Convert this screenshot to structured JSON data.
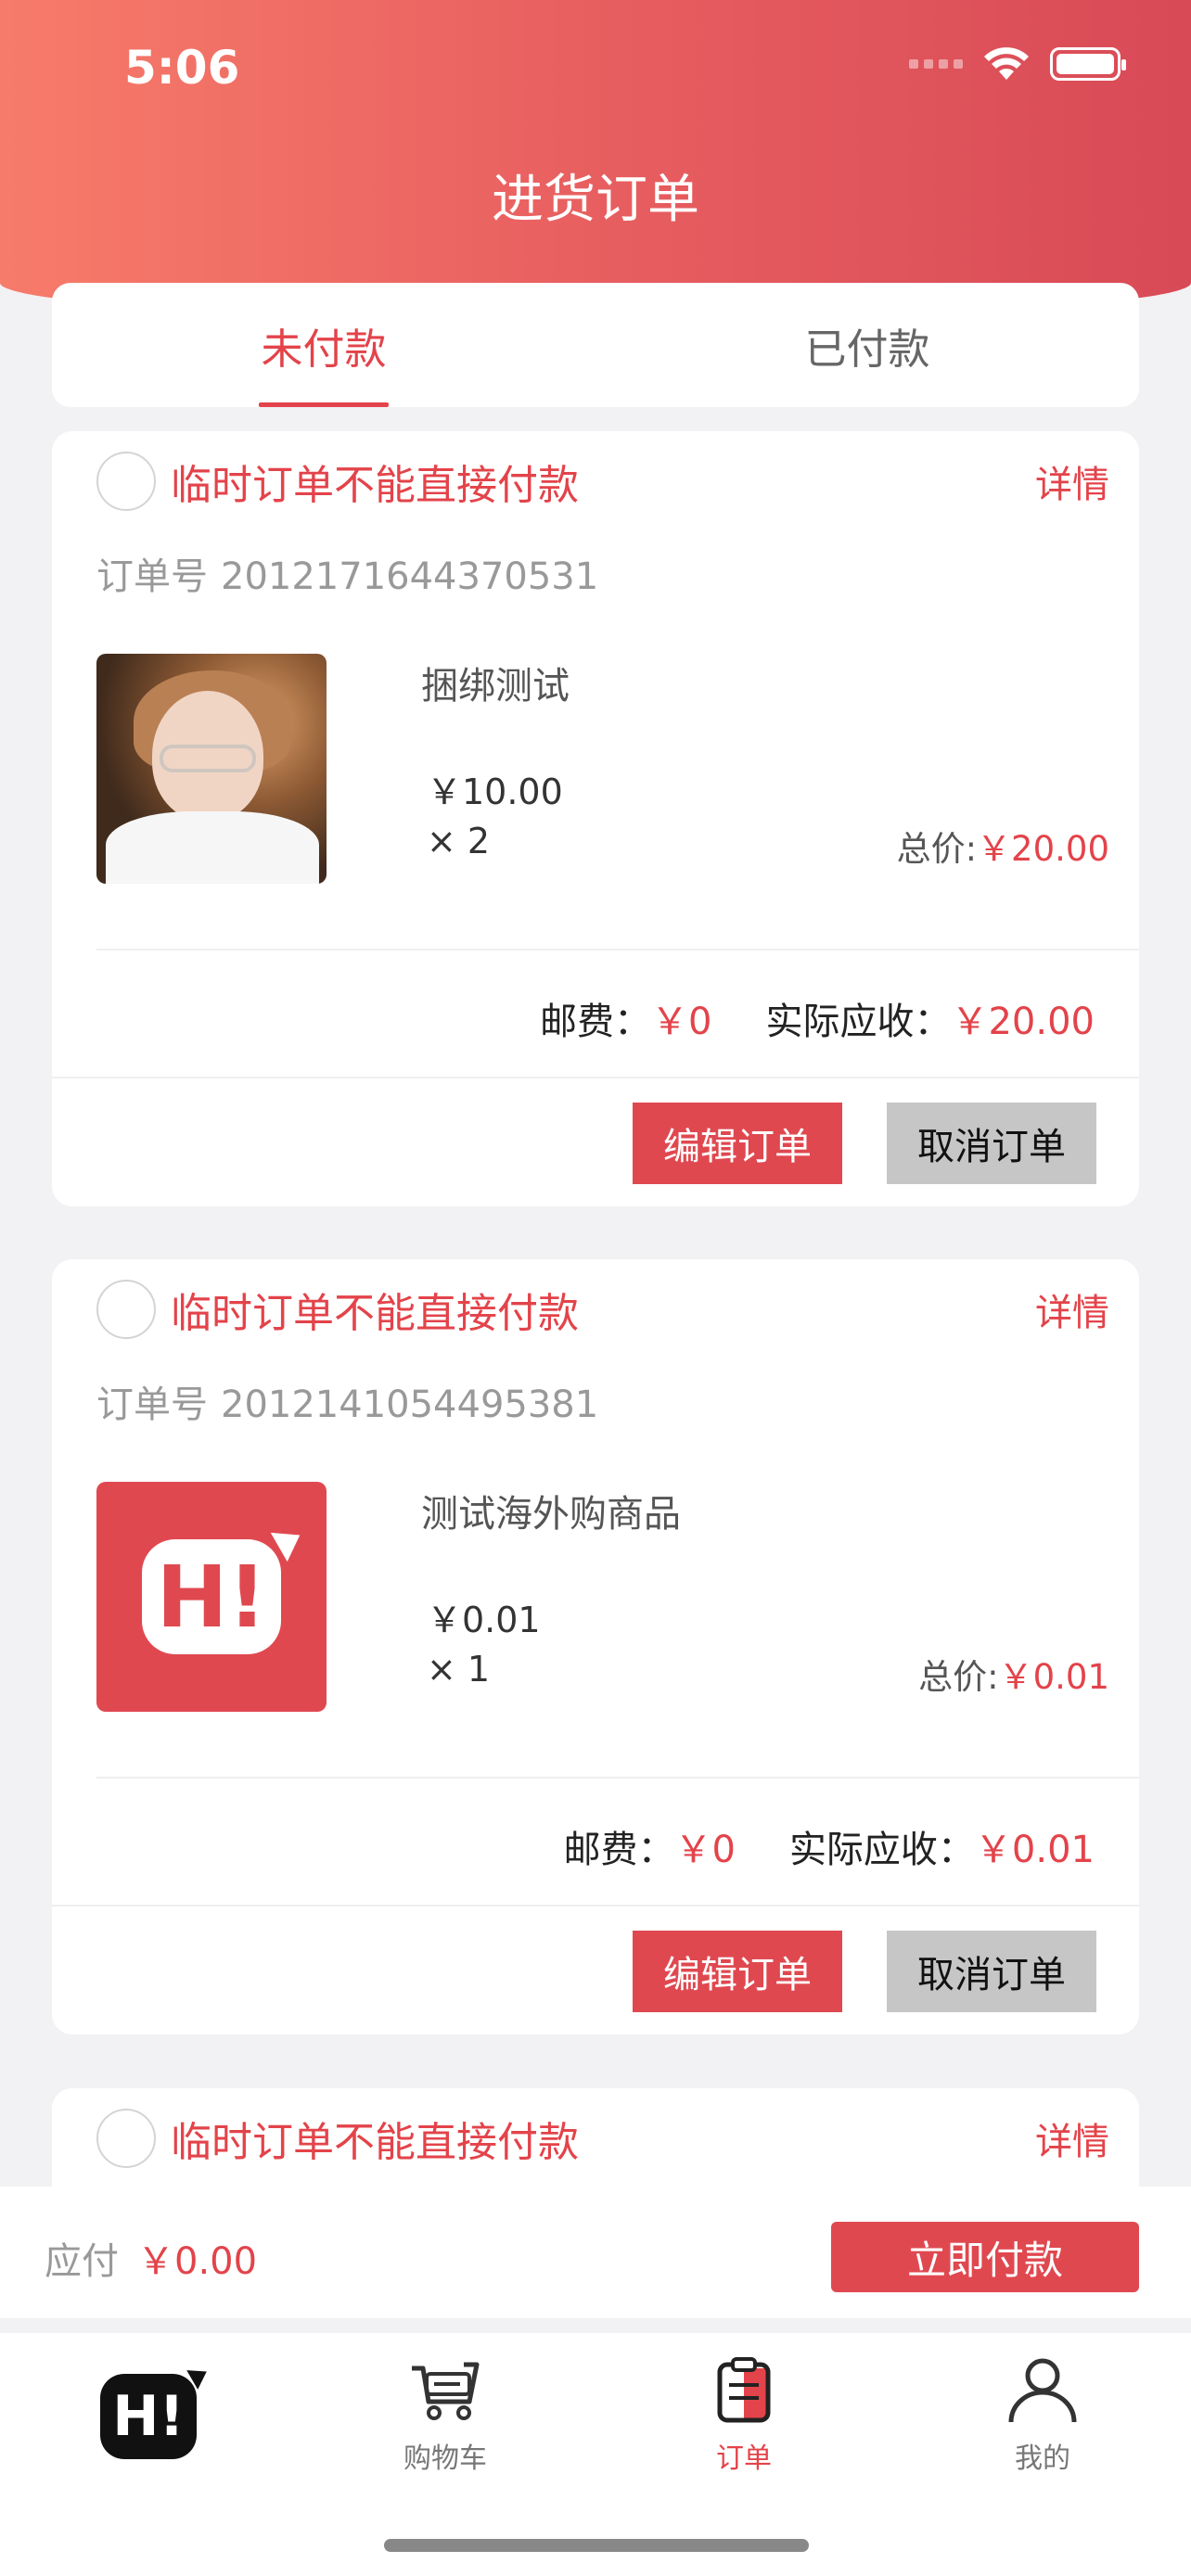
{
  "status_bar": {
    "time": "5:06"
  },
  "header": {
    "title": "进货订单"
  },
  "tabs": [
    {
      "label": "未付款",
      "active": true
    },
    {
      "label": "已付款",
      "active": false
    }
  ],
  "orders": [
    {
      "warning": "临时订单不能直接付款",
      "detail_label": "详情",
      "order_no_label": "订单号",
      "order_no": "2012171644370531",
      "product_name": "捆绑测试",
      "price": "￥10.00",
      "qty": "× 2",
      "total_label": "总价:",
      "total": "￥20.00",
      "shipping_label": "邮费：",
      "shipping": "￥0",
      "receivable_label": "实际应收：",
      "receivable": "￥20.00",
      "edit_label": "编辑订单",
      "cancel_label": "取消订单"
    },
    {
      "warning": "临时订单不能直接付款",
      "detail_label": "详情",
      "order_no_label": "订单号",
      "order_no": "2012141054495381",
      "product_name": "测试海外购商品",
      "price": "￥0.01",
      "qty": "× 1",
      "total_label": "总价:",
      "total": "￥0.01",
      "shipping_label": "邮费：",
      "shipping": "￥0",
      "receivable_label": "实际应收：",
      "receivable": "￥0.01",
      "edit_label": "编辑订单",
      "cancel_label": "取消订单",
      "logo_text": "H!"
    },
    {
      "warning": "临时订单不能直接付款",
      "detail_label": "详情"
    }
  ],
  "pay_bar": {
    "label": "应付",
    "amount": "￥0.00",
    "button": "立即付款"
  },
  "tabbar": {
    "home_logo": "H!",
    "items": [
      {
        "label": "购物车",
        "icon": "cart-icon"
      },
      {
        "label": "订单",
        "icon": "order-icon",
        "active": true
      },
      {
        "label": "我的",
        "icon": "user-icon"
      }
    ]
  },
  "colors": {
    "accent": "#e3434a",
    "button_red": "#e04850",
    "cancel_gray": "#c6c6c6"
  }
}
